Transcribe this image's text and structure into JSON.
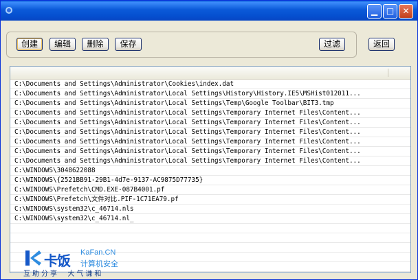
{
  "titlebar": {
    "icon": "app-ring-icon",
    "buttons": [
      {
        "name": "minimize-button",
        "glyph": "▁"
      },
      {
        "name": "maximize-button",
        "glyph": "□"
      },
      {
        "name": "close-button",
        "glyph": "✕"
      }
    ]
  },
  "toolbar": {
    "create_label": "创建",
    "edit_label": "编辑",
    "delete_label": "删除",
    "save_label": "保存",
    "filter_label": "过滤",
    "back_label": "返回"
  },
  "list": {
    "items": [
      "C:\\Documents and Settings\\Administrator\\Cookies\\index.dat",
      "C:\\Documents and Settings\\Administrator\\Local Settings\\History\\History.IE5\\MSHist012011...",
      "C:\\Documents and Settings\\Administrator\\Local Settings\\Temp\\Google Toolbar\\BIT3.tmp",
      "C:\\Documents and Settings\\Administrator\\Local Settings\\Temporary Internet Files\\Content...",
      "C:\\Documents and Settings\\Administrator\\Local Settings\\Temporary Internet Files\\Content...",
      "C:\\Documents and Settings\\Administrator\\Local Settings\\Temporary Internet Files\\Content...",
      "C:\\Documents and Settings\\Administrator\\Local Settings\\Temporary Internet Files\\Content...",
      "C:\\Documents and Settings\\Administrator\\Local Settings\\Temporary Internet Files\\Content...",
      "C:\\Documents and Settings\\Administrator\\Local Settings\\Temporary Internet Files\\Content...",
      "C:\\WINDOWS\\3048622088",
      "C:\\WINDOWS\\{2521BB91-29B1-4d7e-9137-AC9875D77735}",
      "C:\\WINDOWS\\Prefetch\\CMD.EXE-087B4001.pf",
      "C:\\WINDOWS\\Prefetch\\文件对比.PIF-1C71EA79.pf",
      "C:\\WINDOWS\\system32\\c_46714.nls",
      "C:\\WINDOWS\\system32\\c_46714.nl_"
    ]
  },
  "watermark": {
    "brand_cn": "卡饭",
    "brand_en": "KaFan.CN",
    "brand_sub": "计算机安全",
    "slogan": "互助分享  大气谦和"
  },
  "colors": {
    "titlebar": "#0a5fd8",
    "window_bg": "#ece9d8",
    "list_border": "#7f9db9",
    "brand_blue": "#1558c8",
    "brand_light": "#2f8de0"
  }
}
